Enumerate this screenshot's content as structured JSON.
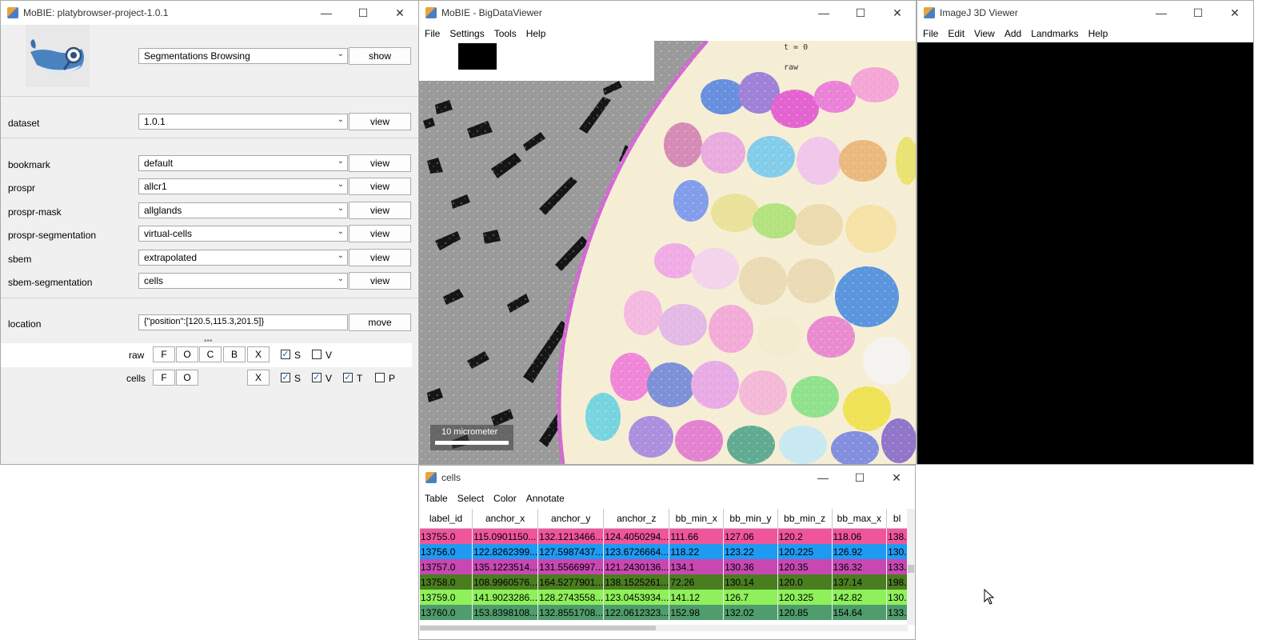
{
  "mobie": {
    "title": "MoBIE: platybrowser-project-1.0.1",
    "source_combo": "Segmentations Browsing",
    "show_label": "show",
    "dataset": {
      "label": "dataset",
      "value": "1.0.1",
      "button": "view"
    },
    "layers": [
      {
        "label": "bookmark",
        "value": "default",
        "button": "view"
      },
      {
        "label": "prospr",
        "value": "allcr1",
        "button": "view"
      },
      {
        "label": "prospr-mask",
        "value": "allglands",
        "button": "view"
      },
      {
        "label": "prospr-segmentation",
        "value": "virtual-cells",
        "button": "view"
      },
      {
        "label": "sbem",
        "value": "extrapolated",
        "button": "view"
      },
      {
        "label": "sbem-segmentation",
        "value": "cells",
        "button": "view"
      }
    ],
    "location": {
      "label": "location",
      "value": "{\"position\":[120.5,115.3,201.5]}",
      "button": "move"
    },
    "sources": [
      {
        "name": "raw",
        "buttons": [
          "F",
          "O",
          "C",
          "B",
          "X"
        ],
        "checks": [
          {
            "label": "S",
            "checked": true
          },
          {
            "label": "V",
            "checked": false
          }
        ]
      },
      {
        "name": "cells",
        "buttons": [
          "F",
          "O",
          "X"
        ],
        "checks": [
          {
            "label": "S",
            "checked": true
          },
          {
            "label": "V",
            "checked": true
          },
          {
            "label": "T",
            "checked": true
          },
          {
            "label": "P",
            "checked": false
          }
        ]
      }
    ]
  },
  "bdv": {
    "title": "MoBIE - BigDataViewer",
    "menu": [
      "File",
      "Settings",
      "Tools",
      "Help"
    ],
    "time": "t = 0",
    "source_name": "raw",
    "scalebar": "10 micrometer"
  },
  "viewer3d": {
    "title": "ImageJ 3D Viewer",
    "menu": [
      "File",
      "Edit",
      "View",
      "Add",
      "Landmarks",
      "Help"
    ]
  },
  "cells_table": {
    "title": "cells",
    "menu": [
      "Table",
      "Select",
      "Color",
      "Annotate"
    ],
    "columns": [
      "label_id",
      "anchor_x",
      "anchor_y",
      "anchor_z",
      "bb_min_x",
      "bb_min_y",
      "bb_min_z",
      "bb_max_x",
      "bl"
    ],
    "rows": [
      {
        "color": "#f0559c",
        "cells": [
          "13755.0",
          "115.0901150...",
          "132.1213466...",
          "124.4050294...",
          "111.66",
          "127.06",
          "120.2",
          "118.06",
          "138."
        ]
      },
      {
        "color": "#1f9af2",
        "cells": [
          "13756.0",
          "122.8262399...",
          "127.5987437...",
          "123.6726664...",
          "118.22",
          "123.22",
          "120.225",
          "126.92",
          "130."
        ]
      },
      {
        "color": "#c848b2",
        "cells": [
          "13757.0",
          "135.1223514...",
          "131.5566997...",
          "121.2430136...",
          "134.1",
          "130.36",
          "120.35",
          "136.32",
          "133."
        ]
      },
      {
        "color": "#4a7d20",
        "cells": [
          "13758.0",
          "108.9960576...",
          "164.5277901...",
          "138.1525261...",
          "72.26",
          "130.14",
          "120.0",
          "137.14",
          "198."
        ]
      },
      {
        "color": "#8ef05a",
        "cells": [
          "13759.0",
          "141.9023286...",
          "128.2743558...",
          "123.0453934...",
          "141.12",
          "126.7",
          "120.325",
          "142.82",
          "130."
        ]
      },
      {
        "color": "#4f9c6c",
        "cells": [
          "13760.0",
          "153.8398108...",
          "132.8551708...",
          "122.0612323...",
          "152.98",
          "132.02",
          "120.85",
          "154.64",
          "133."
        ]
      }
    ]
  },
  "window_controls": {
    "minimize": "—",
    "maximize": "☐",
    "close": "✕"
  }
}
